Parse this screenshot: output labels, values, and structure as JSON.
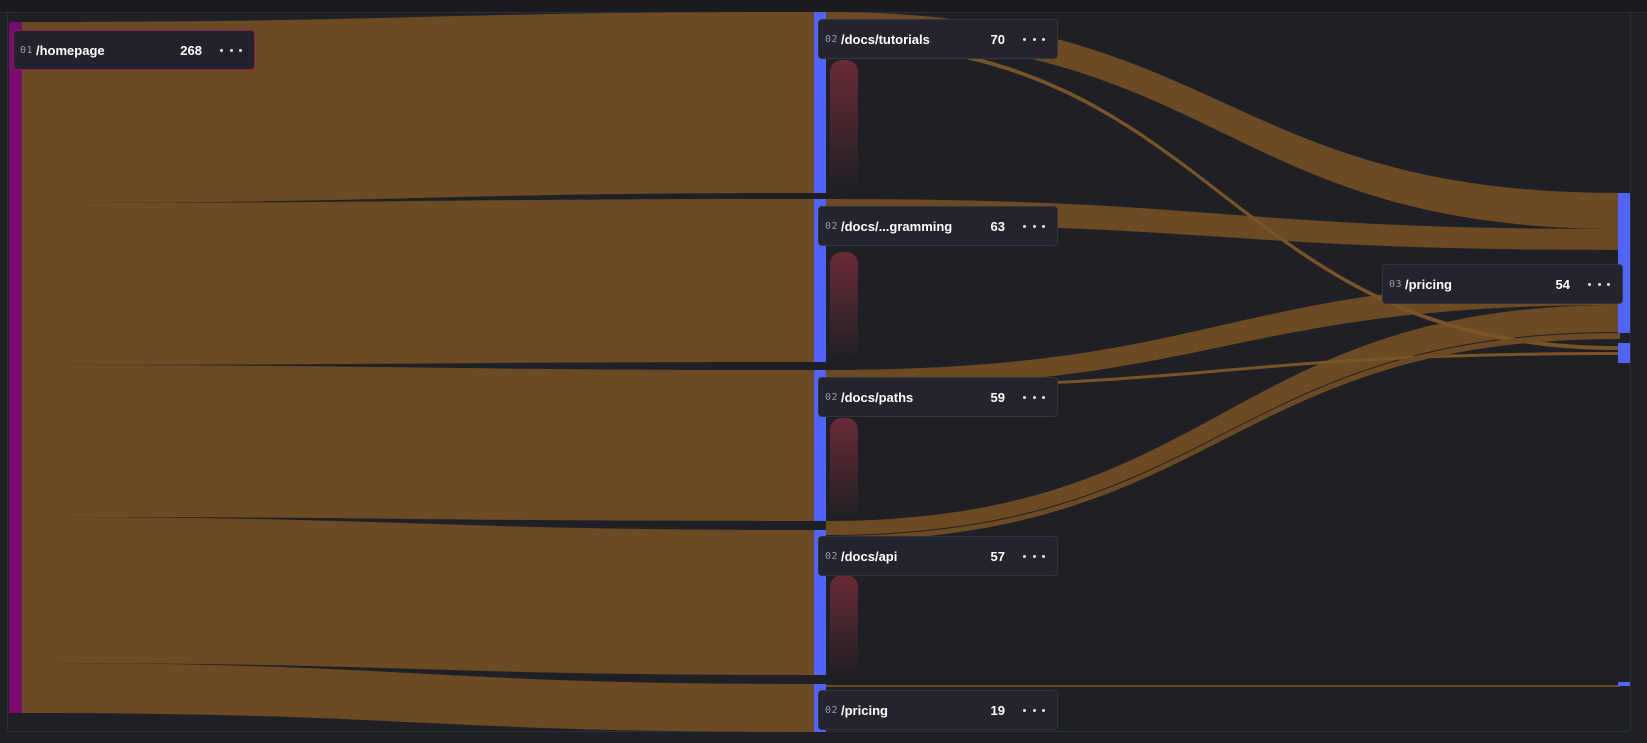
{
  "diagram": {
    "type": "sankey",
    "colors": {
      "background": "#1f2026",
      "flow": "#6b4a24",
      "flow_highlight": "#7a5426",
      "root_bar": "#7a0b6e",
      "node_bar": "#4f63ff",
      "dropoff": "#5a2630"
    },
    "nodes": [
      {
        "id": "n0",
        "step": "01",
        "path": "/homepage",
        "count": 268,
        "root": true
      },
      {
        "id": "n1",
        "step": "02",
        "path": "/docs/tutorials",
        "count": 70
      },
      {
        "id": "n2",
        "step": "02",
        "path": "/docs/...gramming",
        "count": 63
      },
      {
        "id": "n3",
        "step": "02",
        "path": "/docs/paths",
        "count": 59
      },
      {
        "id": "n4",
        "step": "02",
        "path": "/docs/api",
        "count": 57
      },
      {
        "id": "n5",
        "step": "02",
        "path": "/pricing",
        "count": 19
      },
      {
        "id": "n6",
        "step": "03",
        "path": "/pricing",
        "count": 54
      }
    ],
    "more_icon": "ellipsis-icon"
  }
}
